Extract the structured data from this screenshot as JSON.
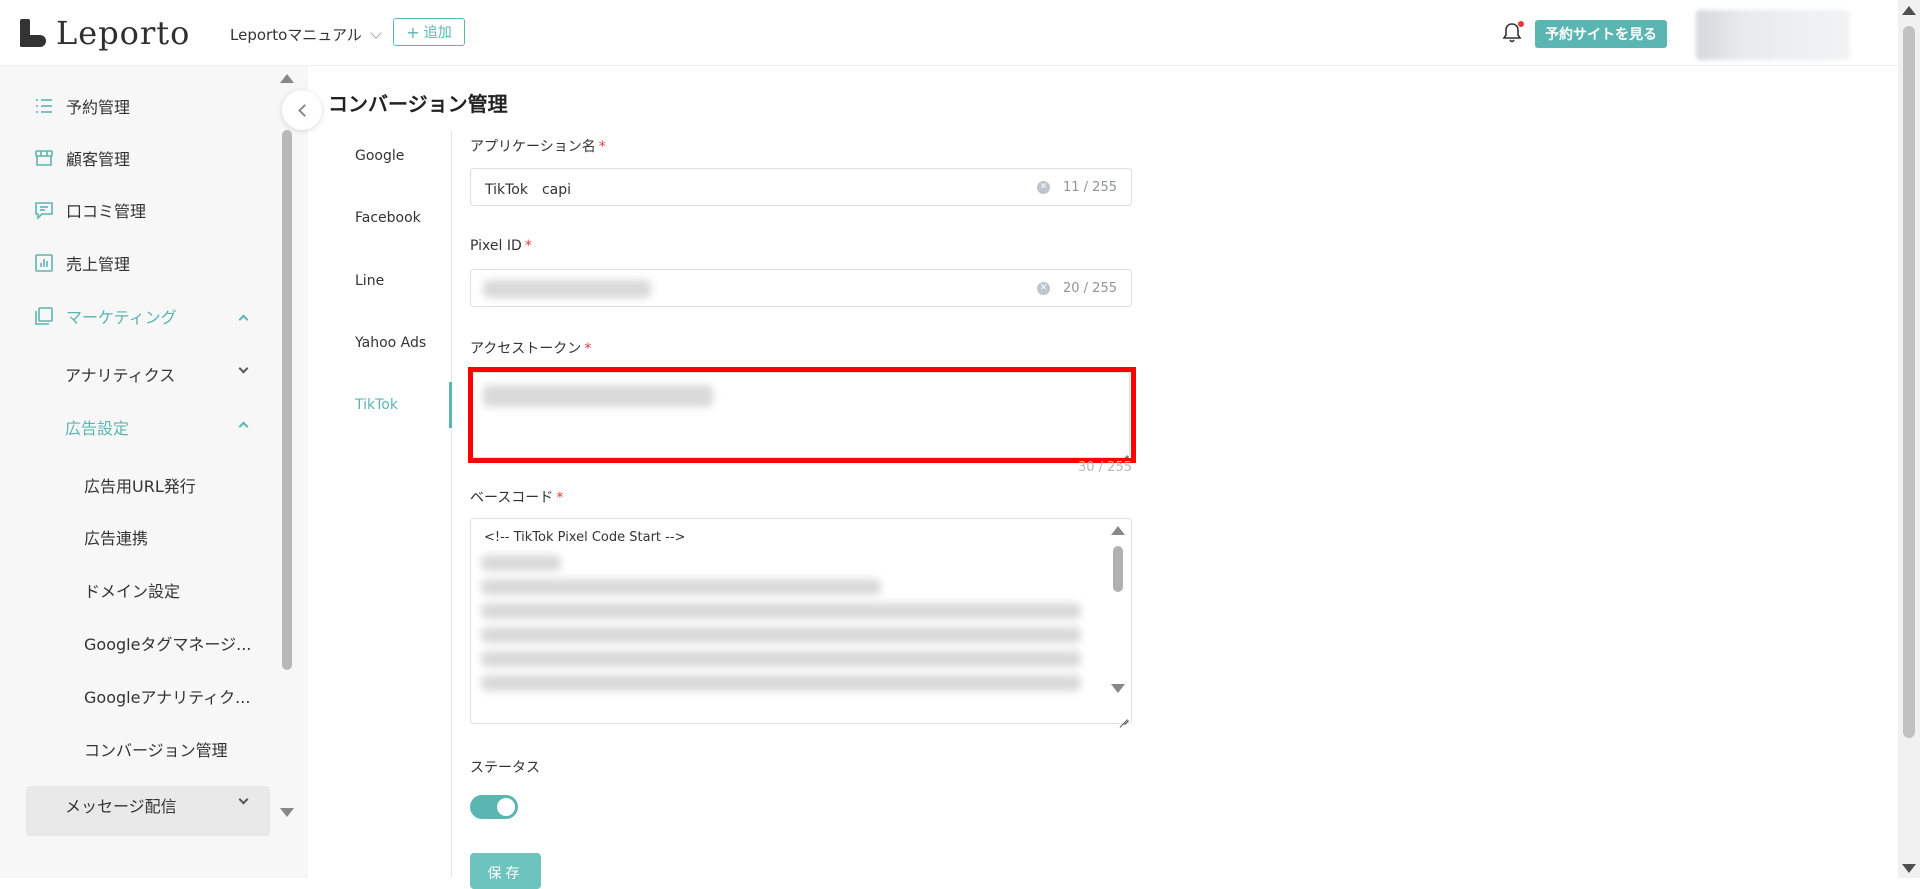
{
  "header": {
    "logo_text": "Leporto",
    "site_name": "Leportoマニュアル",
    "add_label": "追加",
    "view_site_label": "予約サイトを見る"
  },
  "sidebar": {
    "items": [
      {
        "label": "予約管理",
        "icon": "list-icon"
      },
      {
        "label": "顧客管理",
        "icon": "store-icon"
      },
      {
        "label": "口コミ管理",
        "icon": "comment-icon"
      },
      {
        "label": "売上管理",
        "icon": "chart-icon"
      },
      {
        "label": "マーケティング",
        "icon": "marketing-icon"
      }
    ],
    "sub_items": [
      {
        "label": "アナリティクス"
      },
      {
        "label": "広告設定"
      }
    ],
    "ad_items": [
      {
        "label": "広告用URL発行"
      },
      {
        "label": "広告連携"
      },
      {
        "label": "ドメイン設定"
      },
      {
        "label": "Googleタグマネージ..."
      },
      {
        "label": "Googleアナリティク..."
      },
      {
        "label": "コンバージョン管理"
      }
    ],
    "message_item": {
      "label": "メッセージ配信"
    }
  },
  "page": {
    "title": "コンバージョン管理",
    "tabs": [
      "Google",
      "Facebook",
      "Line",
      "Yahoo Ads",
      "TikTok"
    ],
    "active_tab": "TikTok"
  },
  "form": {
    "app_name_label": "アプリケーション名",
    "app_name_value": "TikTok　capi",
    "app_name_count": "11 / 255",
    "pixel_id_label": "Pixel ID",
    "pixel_id_count": "20 / 255",
    "access_token_label": "アクセストークン",
    "access_token_count": "30 / 255",
    "base_code_label": "ベースコード",
    "base_code_first_line": "<!-- TikTok Pixel Code Start -->",
    "status_label": "ステータス",
    "status_on": true,
    "save_label": "保存",
    "required_mark": "*"
  },
  "colors": {
    "accent": "#5bb5b0",
    "required": "#e4393c",
    "highlight": "#ff0000"
  }
}
